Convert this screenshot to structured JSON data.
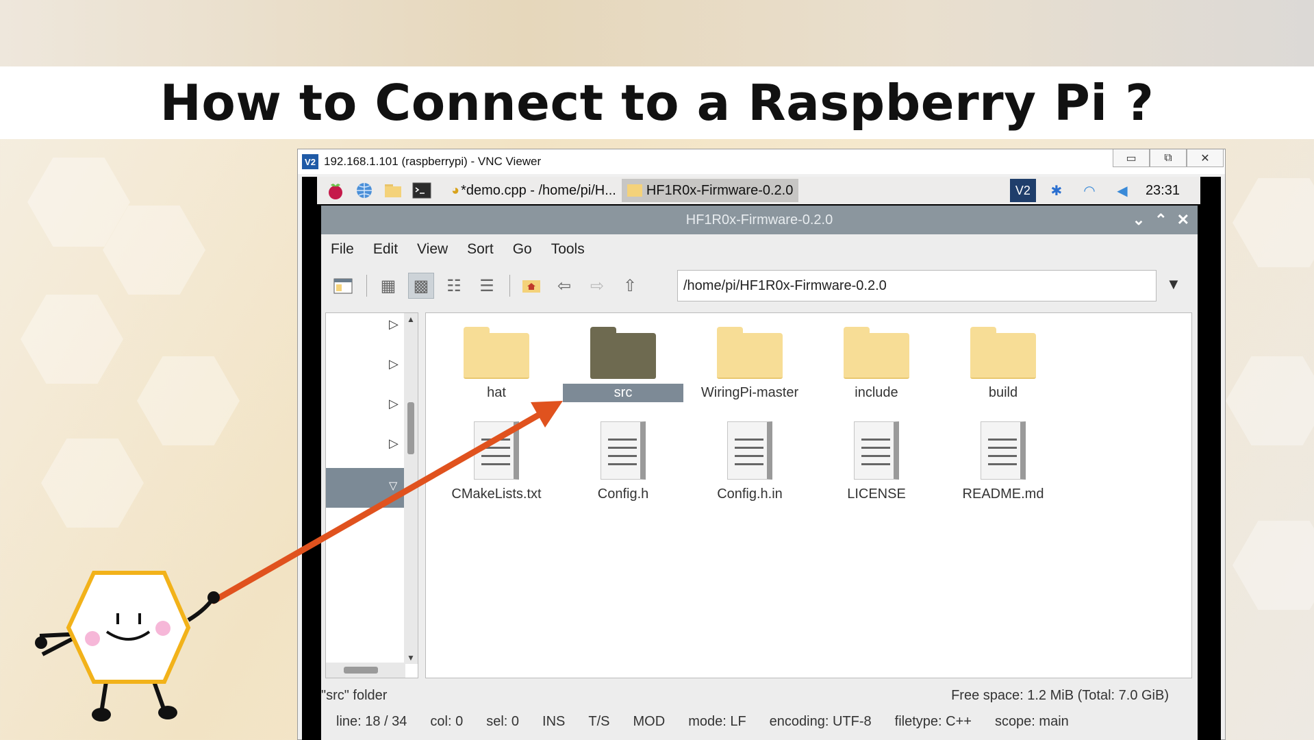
{
  "slide": {
    "title": "How to Connect to a Raspberry Pi ?"
  },
  "vnc": {
    "window_title": "192.168.1.101 (raspberrypi) - VNC Viewer",
    "logo": "V2",
    "controls": [
      "▭",
      "⧉",
      "✕"
    ]
  },
  "pi_panel": {
    "tasks": [
      {
        "label": "*demo.cpp - /home/pi/H...",
        "icon": "geany-icon"
      },
      {
        "label": "HF1R0x-Firmware-0.2.0",
        "icon": "folder-icon"
      }
    ],
    "tray_logo": "V2",
    "clock": "23:31"
  },
  "file_manager": {
    "title": "HF1R0x-Firmware-0.2.0",
    "menu": [
      "File",
      "Edit",
      "View",
      "Sort",
      "Go",
      "Tools"
    ],
    "path": "/home/pi/HF1R0x-Firmware-0.2.0",
    "folders": [
      {
        "name": "hat",
        "selected": false
      },
      {
        "name": "src",
        "selected": true
      },
      {
        "name": "WiringPi-master",
        "selected": false
      },
      {
        "name": "include",
        "selected": false
      },
      {
        "name": "build",
        "selected": false
      }
    ],
    "files": [
      "CMakeLists.txt",
      "Config.h",
      "Config.h.in",
      "LICENSE",
      "README.md"
    ],
    "status_left": "\"src\" folder",
    "status_right": "Free space: 1.2 MiB (Total: 7.0 GiB)"
  },
  "editor_status": {
    "line": "line: 18 / 34",
    "col": "col: 0",
    "sel": "sel: 0",
    "ins": "INS",
    "ts": "T/S",
    "mod": "MOD",
    "mode": "mode: LF",
    "encoding": "encoding: UTF-8",
    "filetype": "filetype: C++",
    "scope": "scope: main"
  },
  "colors": {
    "selection": "#7d8a96",
    "folder": "#f7dd96",
    "folder_selected": "#6e6a50",
    "arrow": "#e0521e",
    "mascot_border": "#f2b21a"
  }
}
